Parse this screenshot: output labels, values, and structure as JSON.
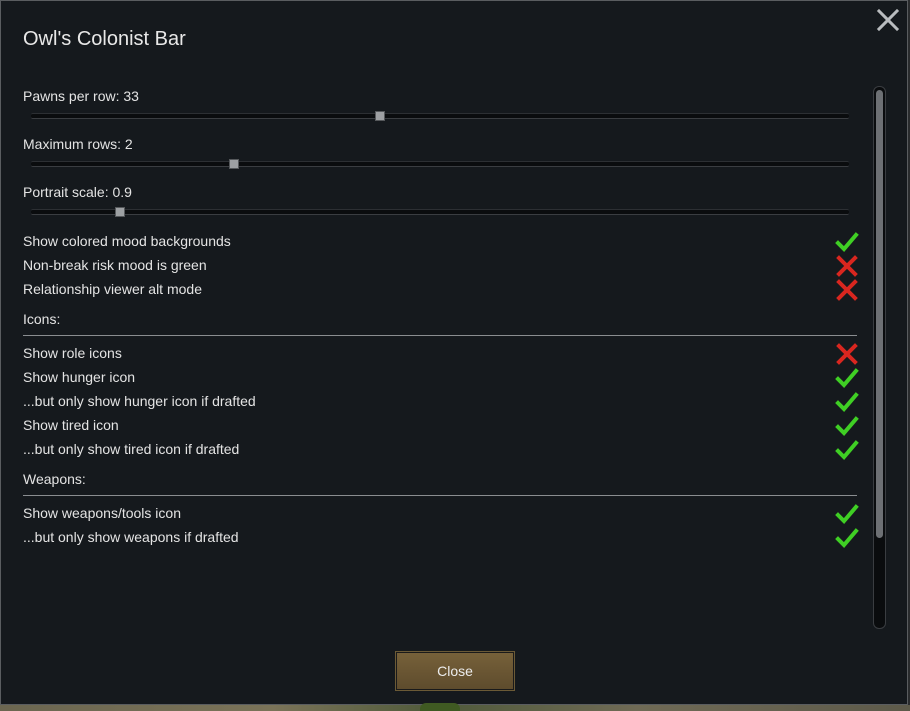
{
  "window": {
    "title": "Owl's Colonist Bar",
    "close_button_label": "Close"
  },
  "sliders": [
    {
      "label": "Pawns per row: 33",
      "value_fraction": 0.425
    },
    {
      "label": "Maximum rows: 2",
      "value_fraction": 0.247
    },
    {
      "label": "Portrait scale: 0.9",
      "value_fraction": 0.108
    }
  ],
  "toggles_general": [
    {
      "label": "Show colored mood backgrounds",
      "checked": true
    },
    {
      "label": "Non-break risk mood is green",
      "checked": false
    },
    {
      "label": "Relationship viewer alt mode",
      "checked": false
    }
  ],
  "sections": {
    "icons": {
      "label": "Icons:",
      "items": [
        {
          "label": "Show role icons",
          "checked": false
        },
        {
          "label": "Show hunger icon",
          "checked": true
        },
        {
          "label": "...but only show hunger icon if drafted",
          "checked": true
        },
        {
          "label": "Show tired icon",
          "checked": true
        },
        {
          "label": "...but only show tired icon if drafted",
          "checked": true
        }
      ]
    },
    "weapons": {
      "label": "Weapons:",
      "items": [
        {
          "label": "Show weapons/tools icon",
          "checked": true
        },
        {
          "label": "...but only show weapons if drafted",
          "checked": true
        }
      ]
    }
  },
  "icons": {
    "check": "check-icon",
    "cross": "cross-icon",
    "close": "close-icon"
  },
  "colors": {
    "check": "#3fcf24",
    "cross": "#d9261f",
    "button": "#6a5633"
  }
}
